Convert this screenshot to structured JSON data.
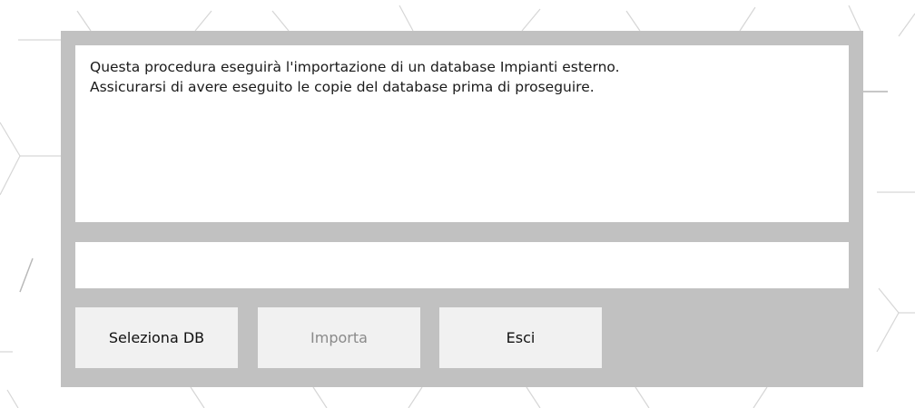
{
  "message": {
    "line1": "Questa procedura eseguirà l'importazione di un database Impianti esterno.",
    "line2": "Assicurarsi di avere eseguito le copie del database prima di proseguire."
  },
  "path_field": {
    "value": ""
  },
  "buttons": {
    "select_label": "Seleziona DB",
    "import_label": "Importa",
    "exit_label": "Esci"
  },
  "colors": {
    "panel": "#c1c1c1",
    "button_bg": "#f1f1f1",
    "disabled_text": "#8a8a8a"
  }
}
